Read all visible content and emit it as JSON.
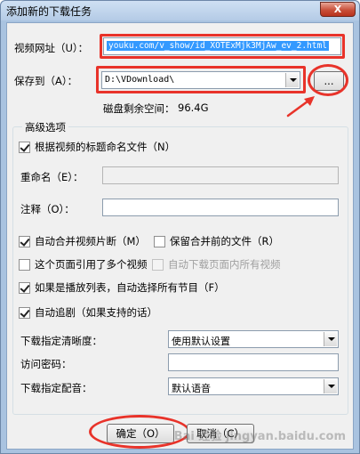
{
  "window": {
    "title": "添加新的下载任务",
    "close_label": "X"
  },
  "url_row": {
    "label": "视频网址（U）：",
    "value": "youku.com/v_show/id_XOTExMjk3MjAw_ev_2.html"
  },
  "save_row": {
    "label": "保存到（A）：",
    "value": "D:\\VDownload\\",
    "browse_label": "...",
    "disk_space_label": "磁盘剩余空间：",
    "disk_space_value": "96.4G"
  },
  "advanced": {
    "title": "高级选项",
    "name_by_title": {
      "label": "根据视频的标题命名文件（N）",
      "checked": true
    },
    "rename": {
      "label": "重命名（E）：",
      "value": ""
    },
    "comment": {
      "label": "注释（O）：",
      "value": ""
    },
    "auto_merge": {
      "label": "自动合并视频片断（M）",
      "checked": true
    },
    "keep_before_merge": {
      "label": "保留合并前的文件（R）",
      "checked": false
    },
    "multi_video_page": {
      "label": "这个页面引用了多个视频",
      "checked": false
    },
    "auto_download_all": {
      "label": "自动下载页面内所有视频",
      "checked": false,
      "disabled": true
    },
    "playlist_select_all": {
      "label": "如果是播放列表，自动选择所有节目（F）",
      "checked": true
    },
    "auto_follow": {
      "label": "自动追剧（如果支持的话）",
      "checked": true
    },
    "quality": {
      "label": "下载指定清晰度：",
      "value": "使用默认设置"
    },
    "password": {
      "label": "访问密码：",
      "value": ""
    },
    "dubbing": {
      "label": "下载指定配音：",
      "value": "默认语音"
    }
  },
  "buttons": {
    "ok": "确定（O）",
    "cancel": "取消（C）"
  },
  "watermark": "Bai 经验 jingyan.baidu.com",
  "colors": {
    "highlight": "#e8332a",
    "selection": "#3399ff",
    "dialog_bg": "#f0f0f0"
  }
}
